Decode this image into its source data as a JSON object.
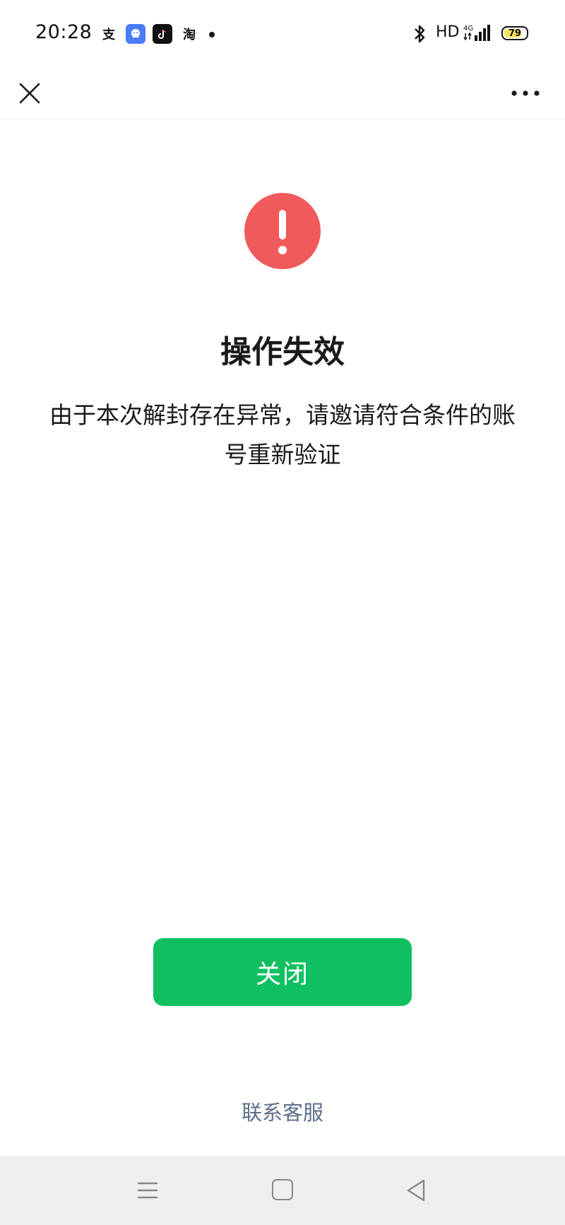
{
  "status_bar": {
    "time": "20:28",
    "app_icons": [
      "alipay-icon",
      "qq-icon",
      "tiktok-icon",
      "taobao-icon"
    ],
    "alipay_glyph": "支",
    "taobao_glyph": "淘",
    "network": "HD",
    "signal": "4G",
    "battery_percent": 79,
    "battery_label": "79"
  },
  "nav": {
    "close_icon": "close-icon",
    "more_icon": "more-icon"
  },
  "main": {
    "icon": "exclamation-icon",
    "icon_color": "#f05a5a",
    "title": "操作失效",
    "message": "由于本次解封存在异常，请邀请符合条件的账号重新验证",
    "close_button_label": "关闭",
    "button_color": "#10c060",
    "support_link": "联系客服",
    "support_color": "#5d6e8a"
  },
  "android_nav": {
    "icons": [
      "menu-icon",
      "home-icon",
      "back-icon"
    ]
  }
}
